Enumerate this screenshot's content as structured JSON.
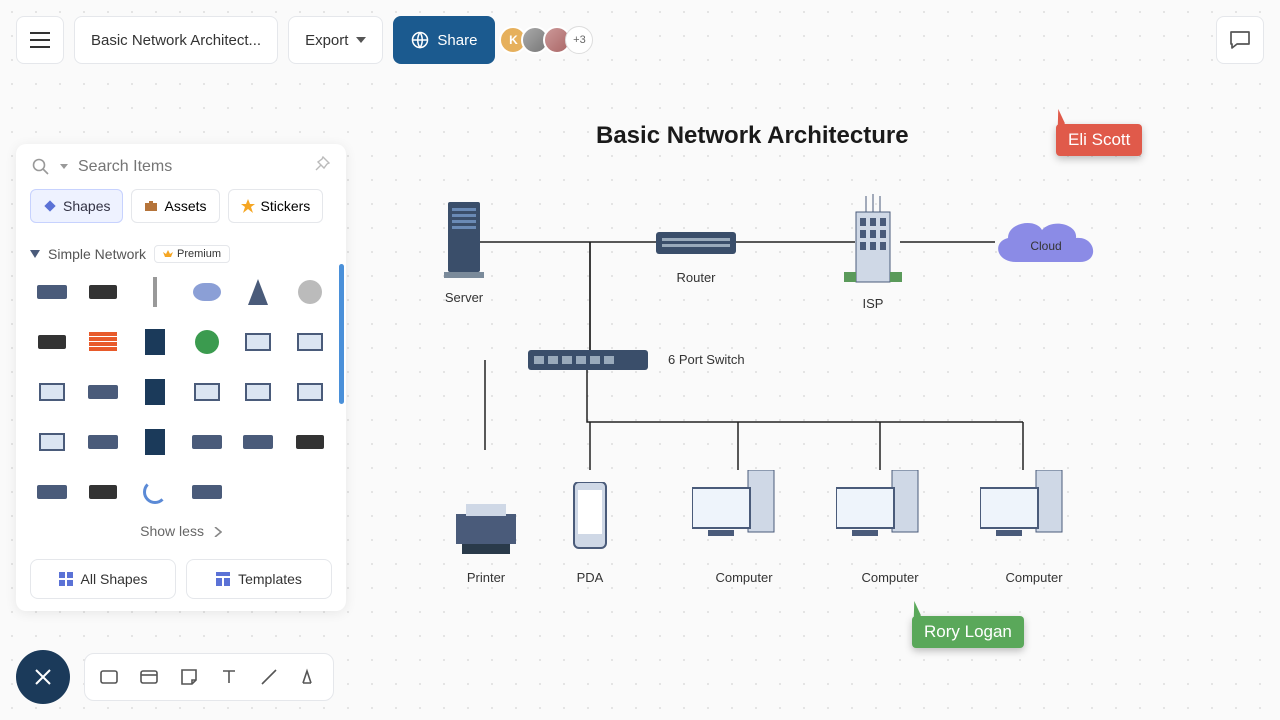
{
  "header": {
    "title": "Basic Network Architect...",
    "export": "Export",
    "share": "Share",
    "avatar_letter": "K",
    "avatar_more": "+3"
  },
  "sidepanel": {
    "search_placeholder": "Search Items",
    "tabs": {
      "shapes": "Shapes",
      "assets": "Assets",
      "stickers": "Stickers"
    },
    "category": "Simple Network",
    "premium": "Premium",
    "showless": "Show less",
    "all_shapes": "All Shapes",
    "templates": "Templates"
  },
  "diagram": {
    "title": "Basic Network Architecture",
    "nodes": {
      "server": "Server",
      "router": "Router",
      "isp": "ISP",
      "cloud": "Cloud",
      "switch": "6 Port Switch",
      "printer": "Printer",
      "pda": "PDA",
      "computer": "Computer"
    }
  },
  "collab": {
    "eli": "Eli Scott",
    "rory": "Rory Logan"
  }
}
